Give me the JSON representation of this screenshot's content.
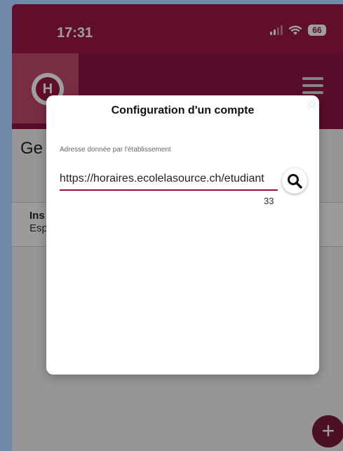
{
  "status_bar": {
    "time": "17:31",
    "battery": "66",
    "icons": [
      "signal-icon",
      "wifi-icon",
      "battery-icon"
    ]
  },
  "header": {
    "logo_letter": "H",
    "menu_icon": "hamburger-menu-icon"
  },
  "page": {
    "title": "Ge",
    "list_item": {
      "title": "Ins",
      "subtitle": "Esp"
    }
  },
  "modal": {
    "title": "Configuration d'un compte",
    "close_symbol": "×",
    "field_label": "Adresse donnée par l'établissement",
    "field_value": "https://horaires.ecolelasource.ch/etudiant",
    "char_count": "33",
    "search_icon": "search-icon"
  },
  "fab": {
    "symbol": "+"
  },
  "colors": {
    "primary": "#9c1748",
    "primary_dark": "#8f1544",
    "fab": "#7b1a3c",
    "background": "#6e8aa8"
  }
}
